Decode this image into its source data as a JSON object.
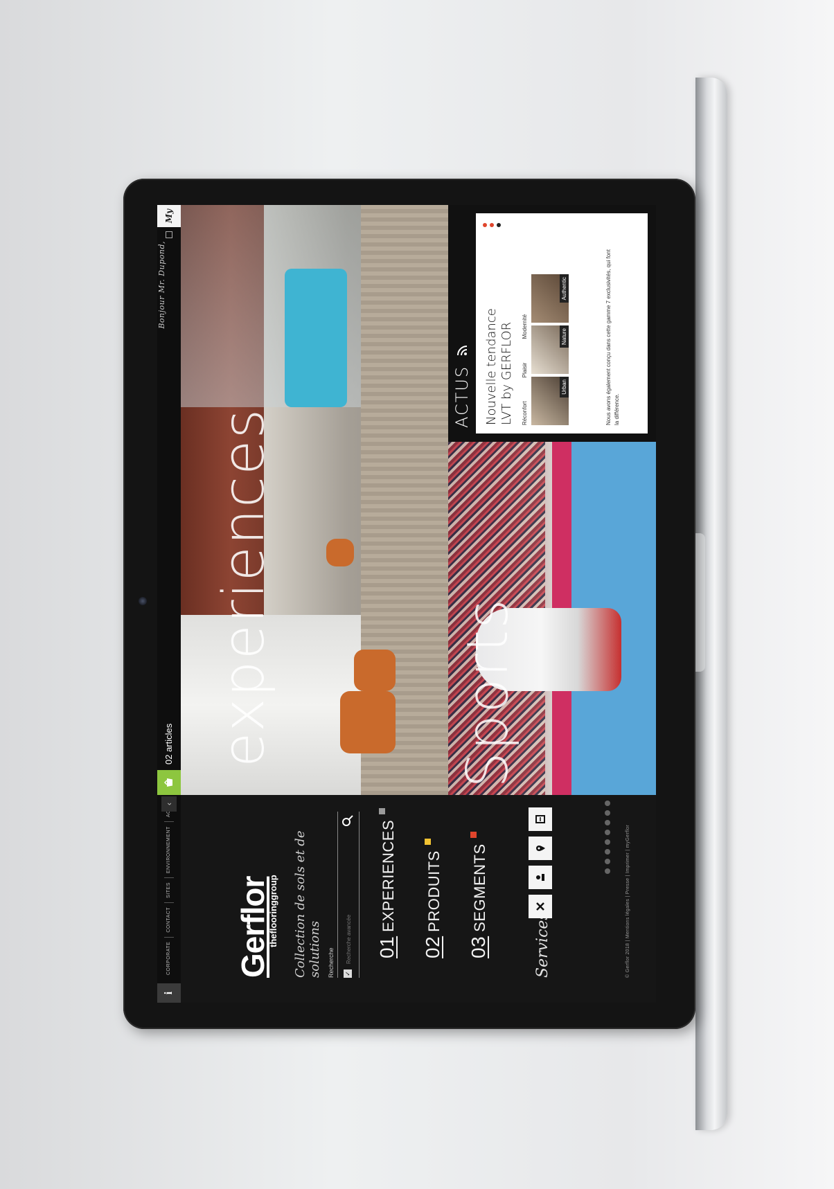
{
  "topbar": {
    "info_label": "i",
    "nav": [
      "CORPORATE",
      "CONTACT",
      "SITES",
      "ENVIRONNEMENT",
      "ACTUS"
    ],
    "articles": "02 articles",
    "greeting": "Bonjour Mr. Dupond,",
    "badge": "My"
  },
  "sidebar": {
    "logo": "Gerflor",
    "logo_sub": "theflooringgroup",
    "tagline": "Collection de sols et de solutions",
    "search_label": "Recherche",
    "search_placeholder": "Recherche avancée",
    "menu": [
      {
        "num": "01",
        "label": "EXPERIENCES",
        "color": "#9a9a9a"
      },
      {
        "num": "02",
        "label": "PRODUITS",
        "color": "#f1c232"
      },
      {
        "num": "03",
        "label": "SEGMENTS",
        "color": "#e0452c"
      }
    ],
    "services_label": "Services",
    "service_icons": [
      "tools-icon",
      "user-network-icon",
      "location-icon",
      "document-icon"
    ],
    "footer": "© Gerflor 2018 | Mentions légales | Presse | Imprimer | myGerflor"
  },
  "panels": {
    "experiences_title": "experiences",
    "sports_title": "Sports"
  },
  "actus": {
    "title": "ACTUS",
    "card_title": "Nouvelle tendance LVT by GERFLOR",
    "labels": [
      "Réconfort",
      "Plaisir",
      "Modernité"
    ],
    "tags": [
      "Urban",
      "Nature",
      "Authentic"
    ],
    "description": "Nous avons également conçu dans cette gamme 7 exclusivités, qui font la différence."
  },
  "colors": {
    "accent_green": "#8dc63f",
    "dot_red": "#e0452c"
  }
}
